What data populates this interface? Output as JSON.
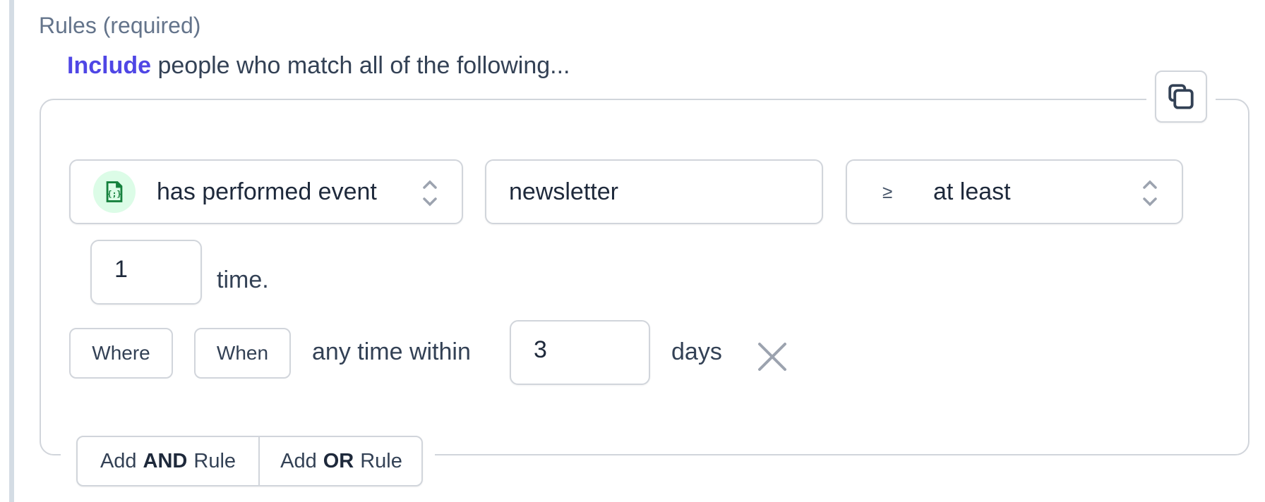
{
  "section": {
    "label": "Rules (required)"
  },
  "intro": {
    "keyword": "Include",
    "text": "people who match all of the following...",
    "keyword_color": "#4f46e5"
  },
  "toolbar": {
    "copy_icon": "copy-icon"
  },
  "rule": {
    "condition_select": {
      "icon": "event-code-file-icon",
      "icon_color": "#15803d",
      "icon_bg": "#dcfce7",
      "value": "has performed event"
    },
    "event_input": {
      "value": "newsletter"
    },
    "operator_select": {
      "symbol": "≥",
      "value": "at least"
    },
    "count_input": {
      "value": "1"
    },
    "count_suffix": "time.",
    "where_label": "Where",
    "when_label": "When",
    "within_label": "any time within",
    "days_input": {
      "value": "3"
    },
    "days_suffix": "days",
    "remove_icon": "close-icon"
  },
  "actions": {
    "add_and": {
      "prefix": "Add",
      "keyword": "AND",
      "suffix": "Rule"
    },
    "add_or": {
      "prefix": "Add",
      "keyword": "OR",
      "suffix": "Rule"
    }
  }
}
